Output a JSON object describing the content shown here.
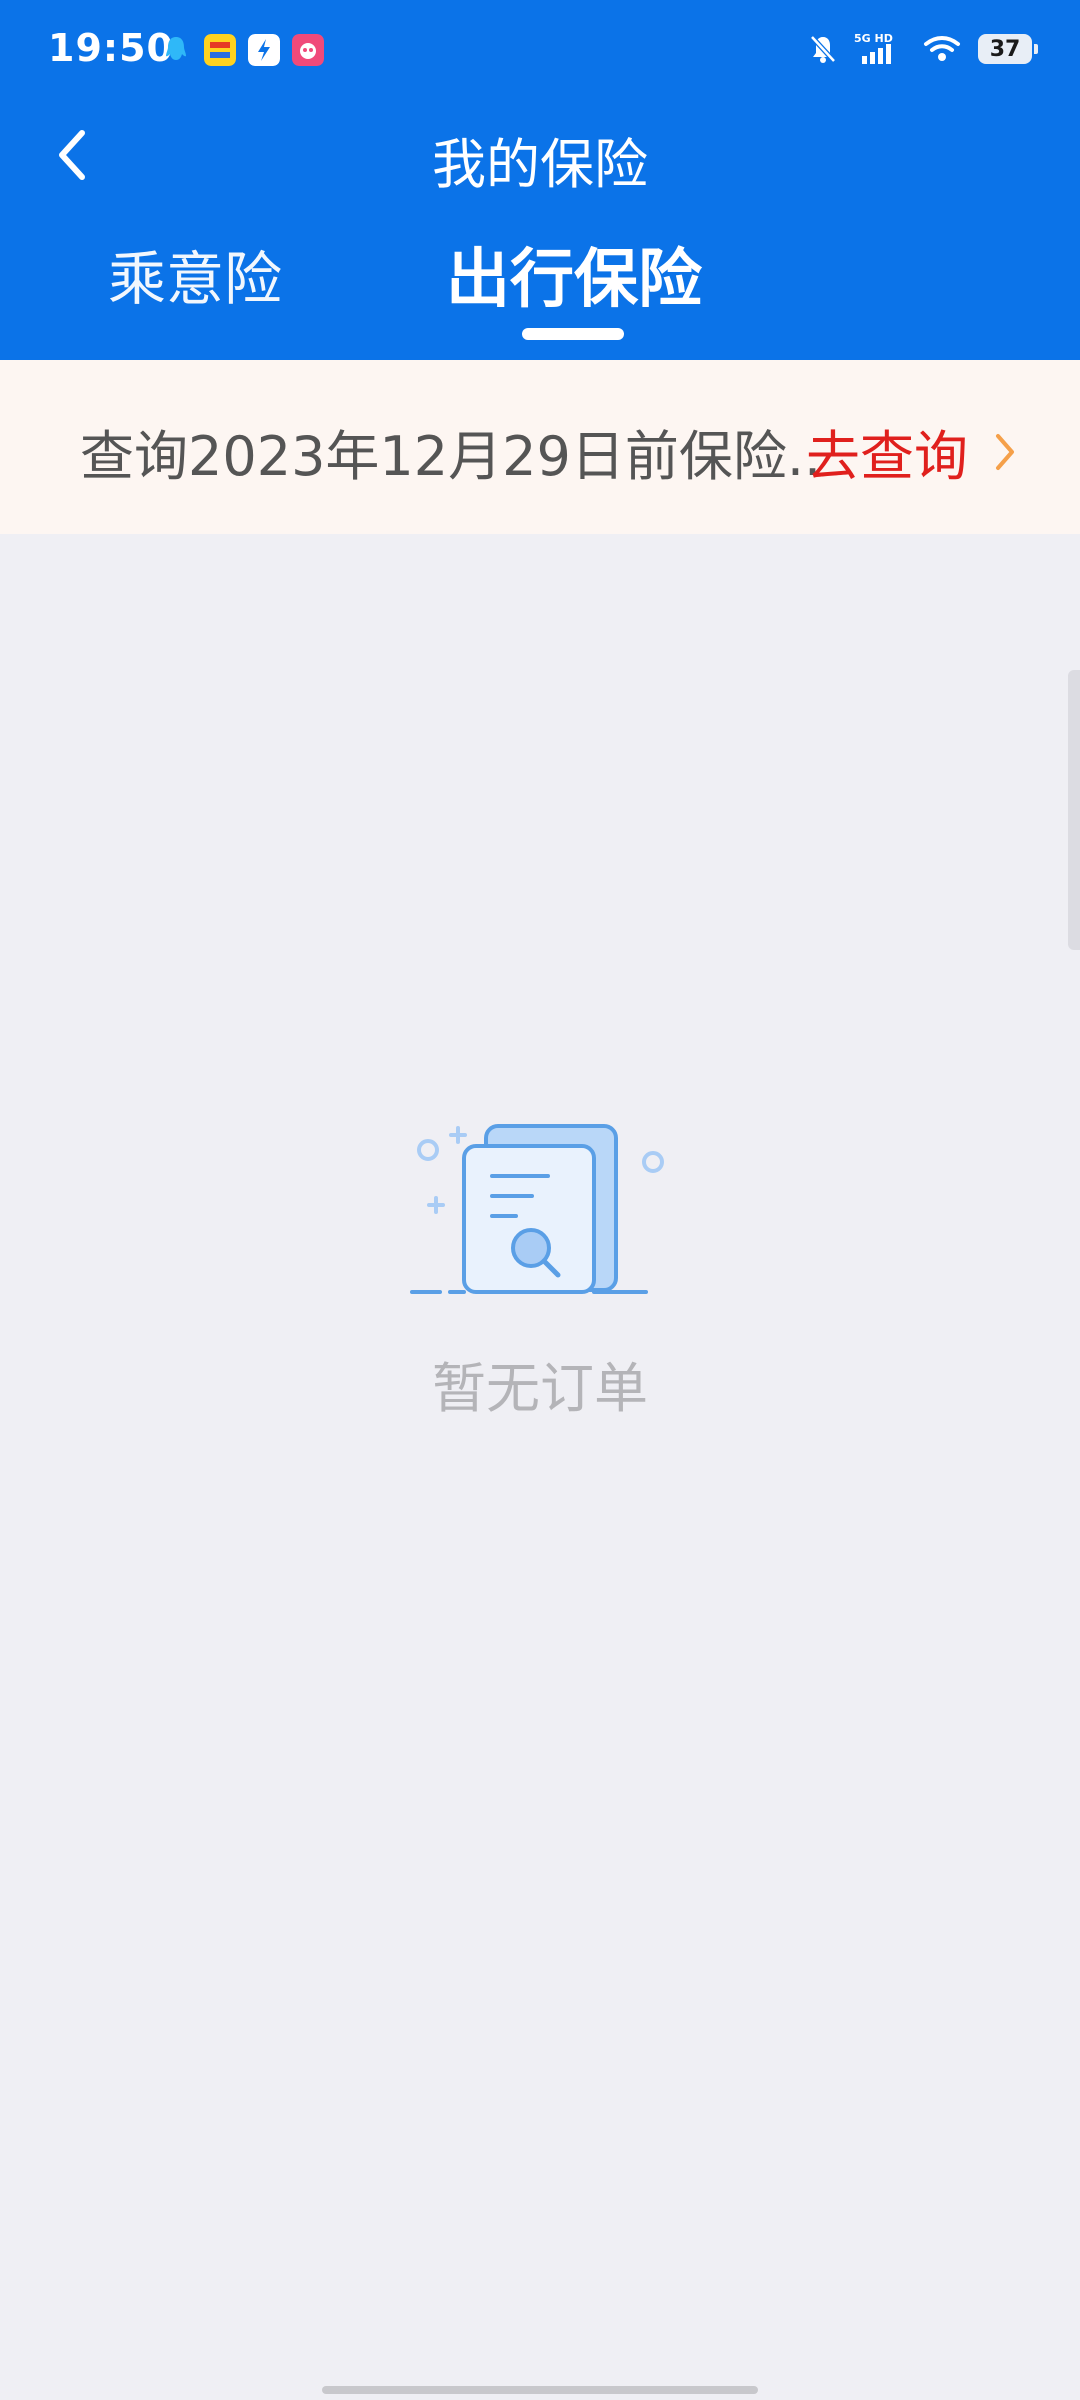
{
  "status_bar": {
    "time": "19:50",
    "battery": "37",
    "network": "5G HD"
  },
  "header": {
    "title": "我的保险",
    "back_icon": "chevron-left-icon"
  },
  "tabs": [
    {
      "label": "乘意险",
      "active": false
    },
    {
      "label": "出行保险",
      "active": true
    }
  ],
  "notice": {
    "text": "查询2023年12月29日前保险..",
    "link": "去查询",
    "arrow_icon": "chevron-right-icon"
  },
  "empty_state": {
    "message": "暂无订单",
    "icon": "document-search-icon"
  },
  "colors": {
    "primary": "#0b73e8",
    "link_red": "#e0201d",
    "arrow_orange": "#f5a04a",
    "background": "#efeff4",
    "notice_bg": "#fdf6f2"
  }
}
